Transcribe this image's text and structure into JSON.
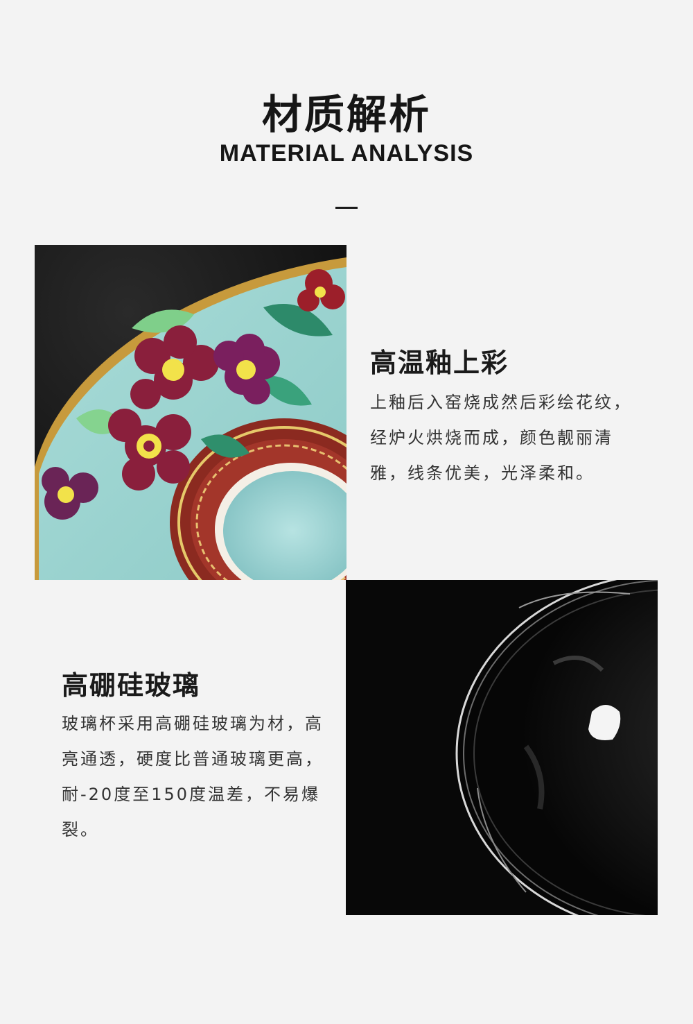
{
  "header": {
    "title": "材质解析",
    "subtitle": "MATERIAL ANALYSIS"
  },
  "features": [
    {
      "heading": "高温釉上彩",
      "body_lines": [
        "上釉后入窑烧成然后彩绘花纹，",
        "经炉火烘烧而成，颜色靓丽清",
        "雅，线条优美，光泽柔和。"
      ],
      "photo": "enamel-cup-closeup"
    },
    {
      "heading": "高硼硅玻璃",
      "body_lines": [
        "玻璃杯采用高硼硅玻璃为材，高",
        "亮通透，硬度比普通玻璃更高，",
        "耐-20度至150度温差，不易爆",
        "裂。"
      ],
      "photo": "glass-cup-closeup"
    }
  ],
  "colors": {
    "background": "#f3f3f3",
    "text": "#1a1a1a",
    "body_text": "#333333",
    "photo_dark": "#0a0a0a"
  }
}
